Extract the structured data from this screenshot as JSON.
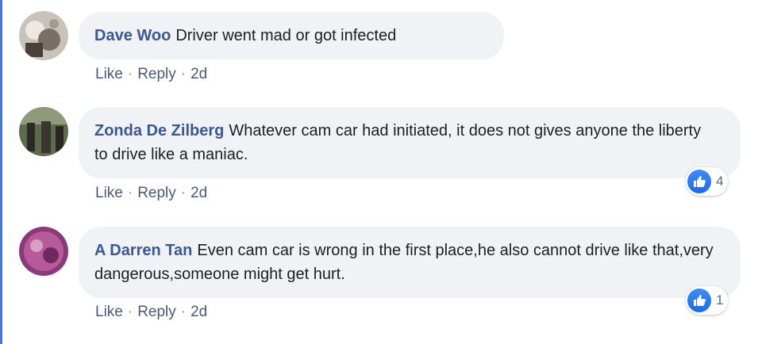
{
  "comments": [
    {
      "author": "Dave Woo",
      "text": "Driver went mad or got infected",
      "actions": {
        "like": "Like",
        "reply": "Reply",
        "time": "2d"
      },
      "reactions": null
    },
    {
      "author": "Zonda De Zilberg",
      "text": "Whatever cam car had initiated, it does not gives anyone the liberty to drive like a maniac.",
      "actions": {
        "like": "Like",
        "reply": "Reply",
        "time": "2d"
      },
      "reactions": "4"
    },
    {
      "author": "A Darren Tan",
      "text": "Even cam car is wrong in the first place,he also cannot drive like that,very dangerous,someone might get hurt.",
      "actions": {
        "like": "Like",
        "reply": "Reply",
        "time": "2d"
      },
      "reactions": "1"
    }
  ],
  "separator": "·",
  "colors": {
    "author": "#385898",
    "bubble": "#f0f2f5",
    "like_blue": "#1b6de8"
  }
}
